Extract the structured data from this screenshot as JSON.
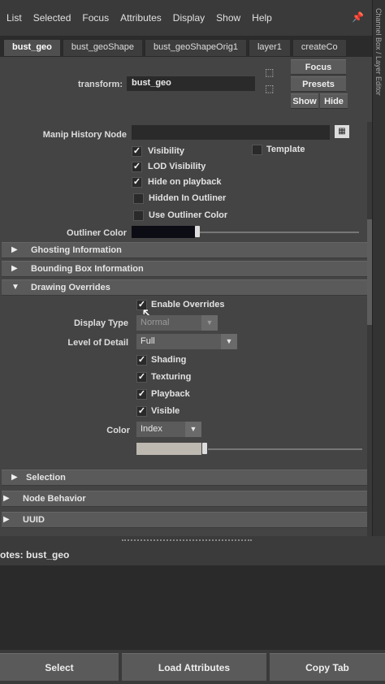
{
  "menu": [
    "List",
    "Selected",
    "Focus",
    "Attributes",
    "Display",
    "Show",
    "Help"
  ],
  "side_strip_text": "Channel Box / Layer Editor",
  "tabs": [
    "bust_geo",
    "bust_geoShape",
    "bust_geoShapeOrig1",
    "layer1",
    "createCo"
  ],
  "transform": {
    "label": "transform:",
    "value": "bust_geo"
  },
  "buttons": {
    "focus": "Focus",
    "presets": "Presets",
    "show": "Show",
    "hide": "Hide"
  },
  "manip_history_label": "Manip History Node",
  "display_checks": [
    {
      "label": "Visibility",
      "checked": true
    },
    {
      "label": "LOD Visibility",
      "checked": true
    },
    {
      "label": "Hide on playback",
      "checked": true
    },
    {
      "label": "Hidden In Outliner",
      "checked": false
    },
    {
      "label": "Use Outliner Color",
      "checked": false
    }
  ],
  "template": {
    "label": "Template",
    "checked": false
  },
  "outliner_color_label": "Outliner Color",
  "sections": {
    "ghosting": "Ghosting Information",
    "bounding": "Bounding Box Information",
    "drawing": "Drawing Overrides",
    "selection": "Selection",
    "node_behavior": "Node Behavior",
    "uuid": "UUID"
  },
  "overrides": {
    "enable_label": "Enable Overrides",
    "enable_checked": true,
    "display_type_label": "Display Type",
    "display_type_value": "Normal",
    "lod_label": "Level of Detail",
    "lod_value": "Full",
    "checks": [
      {
        "label": "Shading",
        "checked": true
      },
      {
        "label": "Texturing",
        "checked": true
      },
      {
        "label": "Playback",
        "checked": true
      },
      {
        "label": "Visible",
        "checked": true
      }
    ],
    "color_label": "Color",
    "color_value": "Index"
  },
  "notes_label": "otes:  bust_geo",
  "bottom_buttons": {
    "select": "Select",
    "load": "Load Attributes",
    "copy": "Copy Tab"
  },
  "colors": {
    "panel": "#444444",
    "dark_field": "#2a2a2a",
    "section_bar": "#5a5a5a"
  }
}
